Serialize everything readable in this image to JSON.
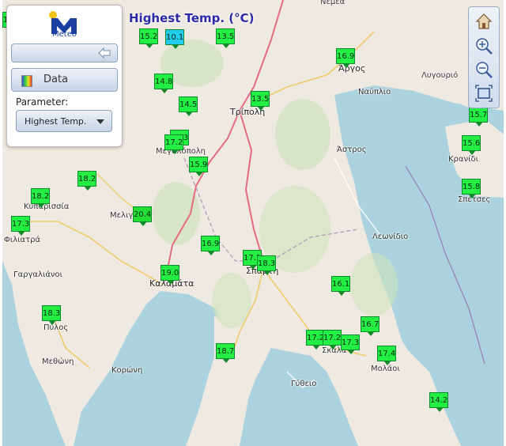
{
  "map_title": "Highest Temp. (°C)",
  "panel": {
    "logo_text": "Meteo",
    "data_button": "Data",
    "parameter_label": "Parameter:",
    "parameter_value": "Highest Temp."
  },
  "colors": {
    "map_title": "#2a2aa8",
    "land": "#efeae1",
    "sea": "#aad3df"
  },
  "controls": [
    "home-icon",
    "zoom-in-icon",
    "zoom-out-icon",
    "extent-icon"
  ],
  "places": [
    {
      "name": "Νεμέα"
    },
    {
      "name": "Άργος"
    },
    {
      "name": "Λυγουριό"
    },
    {
      "name": "Ναύπλιο"
    },
    {
      "name": "Τρίπολη"
    },
    {
      "name": "Μεγαλόπολη"
    },
    {
      "name": "Άστρος"
    },
    {
      "name": "Κρανίδι"
    },
    {
      "name": "Σπέτσες"
    },
    {
      "name": "Κυπαρισσία"
    },
    {
      "name": "Μελιγαλάς"
    },
    {
      "name": "Φιλιατρά"
    },
    {
      "name": "Λεωνίδιο"
    },
    {
      "name": "Γαργαλιάνοι"
    },
    {
      "name": "Καλαμάτα"
    },
    {
      "name": "Σπάρτη"
    },
    {
      "name": "Πύλος"
    },
    {
      "name": "Σκάλα"
    },
    {
      "name": "Μεθώνη"
    },
    {
      "name": "Κορώνη"
    },
    {
      "name": "Μολάοι"
    },
    {
      "name": "Γύθειο"
    }
  ],
  "stations": [
    {
      "value": "15.2",
      "color": "#22ee44"
    },
    {
      "value": "10.1",
      "color": "#22ccee"
    },
    {
      "value": "13.5",
      "color": "#22ee44"
    },
    {
      "value": "16.9",
      "color": "#22ee44"
    },
    {
      "value": "14.8",
      "color": "#22ee44"
    },
    {
      "value": "14.5",
      "color": "#22ee44"
    },
    {
      "value": "13.5",
      "color": "#22ee44"
    },
    {
      "value": "15.7",
      "color": "#22ee44"
    },
    {
      "value": "17.3",
      "color": "#22ee44"
    },
    {
      "value": "17.2",
      "color": "#22ee44"
    },
    {
      "value": "15.9",
      "color": "#22ee44"
    },
    {
      "value": "15.6",
      "color": "#22ee44"
    },
    {
      "value": "18.2",
      "color": "#22ee44"
    },
    {
      "value": "15.8",
      "color": "#22ee44"
    },
    {
      "value": "18.2",
      "color": "#22ee44"
    },
    {
      "value": "20.4",
      "color": "#22dd33"
    },
    {
      "value": "17.3",
      "color": "#22ee44"
    },
    {
      "value": "16.9",
      "color": "#22ee44"
    },
    {
      "value": "17.1",
      "color": "#22ee44"
    },
    {
      "value": "18.3",
      "color": "#22ee44"
    },
    {
      "value": "19.0",
      "color": "#22ee44"
    },
    {
      "value": "16.1",
      "color": "#22ee44"
    },
    {
      "value": "18.3",
      "color": "#22ee44"
    },
    {
      "value": "16.7",
      "color": "#22ee44"
    },
    {
      "value": "17.2",
      "color": "#22ee44"
    },
    {
      "value": "17.2",
      "color": "#22ee44"
    },
    {
      "value": "17.3",
      "color": "#22ee44"
    },
    {
      "value": "18.7",
      "color": "#22ee44"
    },
    {
      "value": "17.4",
      "color": "#22ee44"
    },
    {
      "value": "14.2",
      "color": "#22ee44"
    },
    {
      "value": "18.3",
      "color": "#22ee44"
    }
  ]
}
